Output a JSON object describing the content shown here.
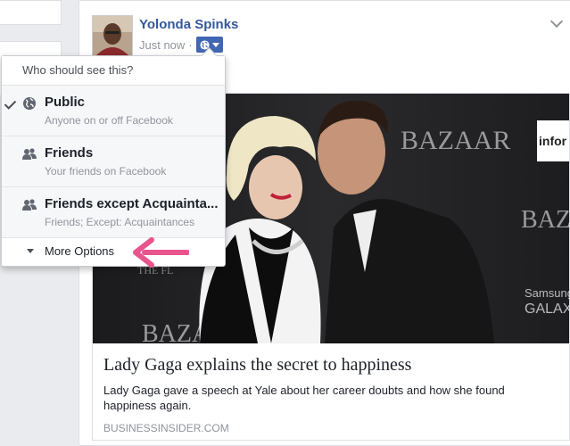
{
  "post": {
    "author": "Yolonda Spinks",
    "timestamp": "Just now",
    "link": {
      "title": "Lady Gaga explains the secret to happiness",
      "description": "Lady Gaga gave a speech at Yale about her career doubts and how she found happiness again.",
      "domain": "BUSINESSINSIDER.COM",
      "photo_text": {
        "bazaar_1": "BAZAAR",
        "bazaar_2": "BAZA",
        "bazaar_3": "BAZA",
        "info": "infor",
        "samsung": "Samsung",
        "galaxy": "GALAX",
        "the": "THE FL"
      }
    }
  },
  "privacy_menu": {
    "header": "Who should see this?",
    "options": [
      {
        "label": "Public",
        "sub": "Anyone on or off Facebook",
        "icon": "globe-icon",
        "selected": true
      },
      {
        "label": "Friends",
        "sub": "Your friends on Facebook",
        "icon": "friends-icon",
        "selected": false
      },
      {
        "label": "Friends except Acquainta...",
        "sub": "Friends; Except: Acquaintances",
        "icon": "friends-except-icon",
        "selected": false
      }
    ],
    "more_options": "More Options"
  },
  "colors": {
    "brand_blue": "#4267b2",
    "link_blue": "#365899",
    "arrow_pink": "#e8548e"
  }
}
